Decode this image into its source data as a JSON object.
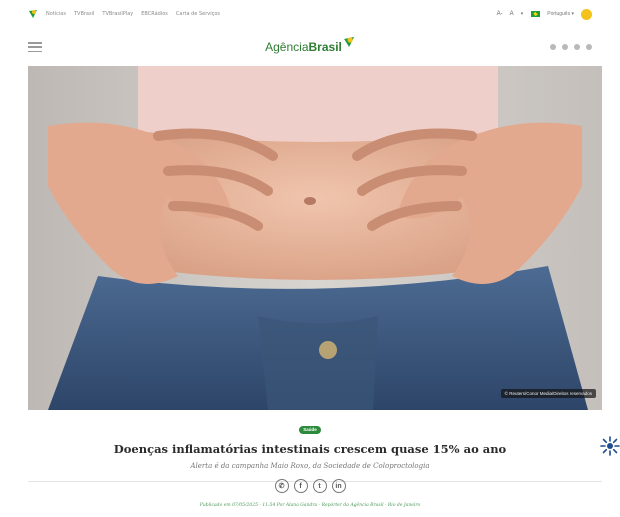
{
  "topbar": {
    "links": [
      "Notícias",
      "TVBrasil",
      "TVBrasilPlay",
      "EBCRádios",
      "Carta de Serviços"
    ],
    "font_controls": [
      "A-",
      "A",
      "◐"
    ],
    "language": "Português ▾"
  },
  "header": {
    "brand_light": "Agência",
    "brand_bold": "Brasil"
  },
  "hero": {
    "credit": "© Reuters/Conor Media/Direitos reservados"
  },
  "article": {
    "tag": "Saúde",
    "headline": "Doenças inflamatórias intestinais crescem quase 15% ao ano",
    "subhead": "Alerta é da campanha Maio Roxo, da Sociedade de Coloproctologia",
    "share_icons": [
      "whatsapp-icon",
      "facebook-icon",
      "twitter-icon",
      "linkedin-icon"
    ],
    "share_glyphs": [
      "✆",
      "f",
      "t",
      "in"
    ],
    "byline": "Publicado em 07/05/2025 - 11:54 Por Alana Gandra - Repórter da Agência Brasil - Rio de Janeiro"
  },
  "colors": {
    "brand_green": "#2e8b3d",
    "brand_yellow": "#f3c21b",
    "denim": "#3f5b82",
    "skin": "#e8b49a",
    "top": "#efcfc9"
  }
}
